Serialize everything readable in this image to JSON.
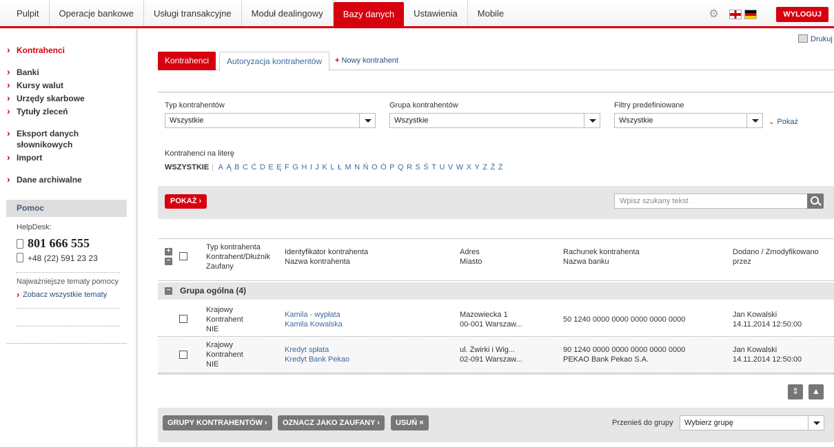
{
  "nav": {
    "items": [
      "Pulpit",
      "Operacje bankowe",
      "Usługi transakcyjne",
      "Moduł dealingowy",
      "Bazy danych",
      "Ustawienia",
      "Mobile"
    ],
    "active_index": 4,
    "logout_label": "WYLOGUJ",
    "accent_color": "#d7000f"
  },
  "sidebar": {
    "items": [
      "Kontrahenci",
      "Banki",
      "Kursy walut",
      "Urzędy skarbowe",
      "Tytuły zleceń",
      "Eksport danych słownikowych",
      "Import",
      "Dane archiwalne"
    ],
    "active_index": 0,
    "help": {
      "title": "Pomoc",
      "helpdesk_label": "HelpDesk:",
      "phone_main": "801 666 555",
      "phone_alt": "+48 (22) 591 23 23",
      "topics_label": "Najważniejsze tematy pomocy",
      "topics_link": "Zobacz wszystkie tematy"
    }
  },
  "main": {
    "print_label": "Drukuj",
    "tabs": [
      "Kontrahenci",
      "Autoryzacja kontrahentów"
    ],
    "new_label": "Nowy kontrahent",
    "filters": {
      "type_label": "Typ kontrahentów",
      "type_value": "Wszystkie",
      "group_label": "Grupa kontrahentów",
      "group_value": "Wszystkie",
      "predef_label": "Filtry predefiniowane",
      "predef_value": "Wszystkie",
      "show_link": "Pokaż",
      "letters_label": "Kontrahenci na literę",
      "letters_all": "WSZYSTKIE",
      "letters": [
        "A",
        "Ą",
        "B",
        "C",
        "Ć",
        "D",
        "E",
        "Ę",
        "F",
        "G",
        "H",
        "I",
        "J",
        "K",
        "L",
        "Ł",
        "M",
        "N",
        "Ń",
        "O",
        "Ó",
        "P",
        "Q",
        "R",
        "S",
        "Ś",
        "T",
        "U",
        "V",
        "W",
        "X",
        "Y",
        "Z",
        "Ź",
        "Ż"
      ],
      "show_button": "POKAŻ",
      "search_placeholder": "Wpisz szukany tekst"
    },
    "table": {
      "headers": {
        "type": [
          "Typ kontrahenta",
          "Kontrahent/Dłużnik",
          "Zaufany"
        ],
        "ident": [
          "Identyfikator kontrahenta",
          "Nazwa kontrahenta"
        ],
        "addr": [
          "Adres",
          "Miasto"
        ],
        "acct": [
          "Rachunek kontrahenta",
          "Nazwa banku"
        ],
        "added": [
          "Dodano / Zmodyfikowano",
          "przez"
        ]
      },
      "group_name": "Grupa ogólna (4)",
      "rows": [
        {
          "type": [
            "Krajowy",
            "Kontrahent",
            "NIE"
          ],
          "ident": [
            "Kamila - wypłata",
            "Kamila Kowalska"
          ],
          "addr": [
            "Mazowiecka 1",
            "00-001 Warszaw..."
          ],
          "acct": [
            "50 1240 0000 0000 0000 0000 0000",
            ""
          ],
          "added": [
            "Jan Kowalski",
            "14.11.2014 12:50:00"
          ]
        },
        {
          "type": [
            "Krajowy",
            "Kontrahent",
            "NIE"
          ],
          "ident": [
            "Kredyt spłata",
            "Kredyt Bank Pekao"
          ],
          "addr": [
            "ul. Żwirki i Wig...",
            "02-091 Warszaw..."
          ],
          "acct": [
            "90 1240 0000 0000 0000 0000 0000",
            "PEKAO Bank Pekao S.A."
          ],
          "added": [
            "Jan Kowalski",
            "14.11.2014 12:50:00"
          ]
        }
      ]
    },
    "actions": {
      "groups": "GRUPY KONTRAHENTÓW",
      "trusted": "OZNACZ JAKO ZAUFANY",
      "delete": "USUŃ",
      "move_label": "Przenieś do grupy",
      "move_placeholder": "Wybierz grupę"
    }
  }
}
